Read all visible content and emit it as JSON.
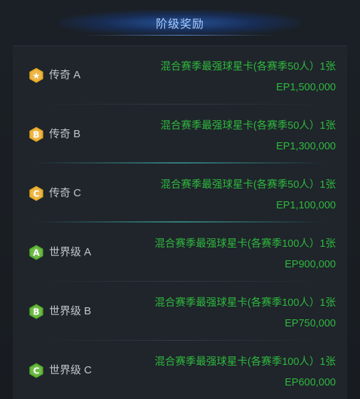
{
  "header": {
    "title": "阶级奖励"
  },
  "tiers": [
    {
      "badge_symbol": "★",
      "badge_color": "#e8a923",
      "name": "传奇 A",
      "reward_line1": "混合赛季最强球星卡(各赛季50人）1张",
      "reward_line2": "EP1,500,000"
    },
    {
      "badge_symbol": "B",
      "badge_color": "#e8a923",
      "name": "传奇 B",
      "reward_line1": "混合赛季最强球星卡(各赛季50人）1张",
      "reward_line2": "EP1,300,000"
    },
    {
      "badge_symbol": "C",
      "badge_color": "#e8a923",
      "name": "传奇 C",
      "reward_line1": "混合赛季最强球星卡(各赛季50人）1张",
      "reward_line2": "EP1,100,000"
    },
    {
      "badge_symbol": "A",
      "badge_color": "#58b02b",
      "name": "世界级 A",
      "reward_line1": "混合赛季最强球星卡(各赛季100人）1张",
      "reward_line2": "EP900,000"
    },
    {
      "badge_symbol": "B",
      "badge_color": "#58b02b",
      "name": "世界级 B",
      "reward_line1": "混合赛季最强球星卡(各赛季100人）1张",
      "reward_line2": "EP750,000"
    },
    {
      "badge_symbol": "C",
      "badge_color": "#58b02b",
      "name": "世界级 C",
      "reward_line1": "混合赛季最强球星卡(各赛季100人）1张",
      "reward_line2": "EP600,000"
    }
  ]
}
